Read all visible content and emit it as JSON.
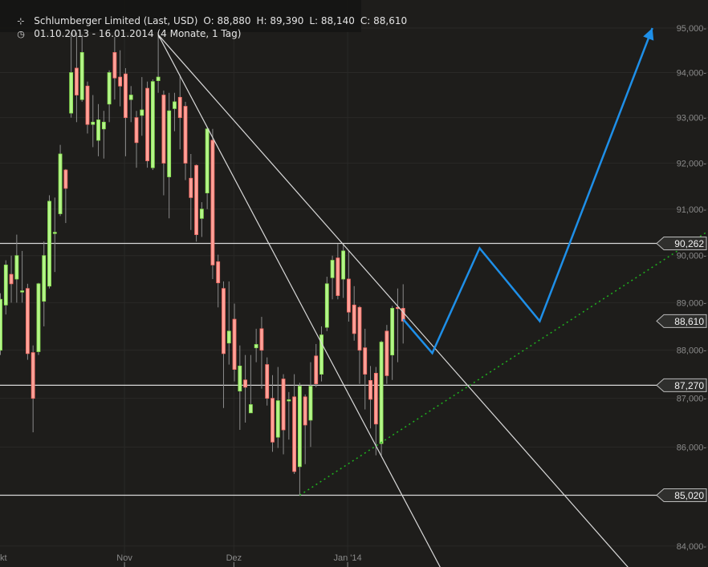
{
  "header": {
    "title": "Schlumberger Limited (Last, USD)",
    "open": "O: 88,880",
    "high": "H: 89,390",
    "low": "L: 88,140",
    "close": "C: 88,610",
    "range": "01.10.2013 - 16.01.2014 (4 Monate, 1 Tag)",
    "title_icon": "chart-bars-icon",
    "range_icon": "clock-icon"
  },
  "chart_data": {
    "type": "candlestick",
    "title": "Schlumberger Limited (Last, USD)",
    "y_scale": "log",
    "ylim": [
      84,
      95
    ],
    "y_ticks": [
      {
        "v": 95,
        "label": "95,000-"
      },
      {
        "v": 94,
        "label": "94,000-"
      },
      {
        "v": 93,
        "label": "93,000-"
      },
      {
        "v": 92,
        "label": "92,000-"
      },
      {
        "v": 91,
        "label": "91,000-"
      },
      {
        "v": 90,
        "label": "90,000-"
      },
      {
        "v": 89,
        "label": "89,000-"
      },
      {
        "v": 88,
        "label": "88,000-"
      },
      {
        "v": 87,
        "label": "87,000-"
      },
      {
        "v": 86,
        "label": "86,000-"
      },
      {
        "v": 84,
        "label": "84,000-"
      }
    ],
    "x_ticks": [
      {
        "index": -0.5,
        "label": "kt"
      },
      {
        "index": 22.8,
        "label": "Nov"
      },
      {
        "index": 42.9,
        "label": "Dez"
      },
      {
        "index": 63.8,
        "label": "Jan '14"
      }
    ],
    "colors": {
      "up_fill": "#b4f58a",
      "up_stroke": "#86e04c",
      "down_fill": "#ffa299",
      "down_stroke": "#f46a62",
      "wick": "#8a8a8a",
      "projection": "#1e8fe8",
      "support": "#1fb51f",
      "line": "#d8d8d8"
    },
    "candles": [
      [
        88.0,
        89.2,
        87.9,
        89.07
      ],
      [
        88.95,
        89.9,
        88.75,
        89.8
      ],
      [
        89.6,
        90.0,
        89.0,
        89.4
      ],
      [
        89.5,
        90.45,
        89.0,
        90.0
      ],
      [
        89.25,
        90.1,
        89.0,
        89.25
      ],
      [
        89.3,
        89.4,
        87.8,
        87.93
      ],
      [
        87.95,
        88.1,
        86.3,
        87.0
      ],
      [
        87.97,
        89.42,
        87.9,
        89.4
      ],
      [
        89.03,
        90.3,
        88.5,
        90.0
      ],
      [
        89.35,
        91.3,
        89.3,
        91.17
      ],
      [
        90.5,
        91.25,
        89.65,
        90.5
      ],
      [
        90.9,
        92.4,
        90.85,
        92.2
      ],
      [
        91.85,
        91.87,
        90.7,
        91.45
      ],
      [
        93.1,
        94.9,
        93.0,
        94.0
      ],
      [
        94.1,
        94.9,
        92.9,
        93.5
      ],
      [
        93.4,
        94.85,
        93.35,
        94.45
      ],
      [
        93.7,
        93.8,
        92.65,
        92.85
      ],
      [
        92.85,
        93.5,
        92.35,
        92.9
      ],
      [
        92.5,
        93.3,
        92.15,
        92.95
      ],
      [
        92.75,
        93.15,
        92.1,
        92.9
      ],
      [
        93.3,
        94.05,
        92.9,
        94.0
      ],
      [
        94.45,
        94.8,
        93.4,
        93.88
      ],
      [
        93.9,
        94.5,
        93.25,
        93.7
      ],
      [
        93.97,
        94.1,
        92.15,
        93.0
      ],
      [
        93.4,
        93.7,
        92.9,
        93.5
      ],
      [
        93.0,
        93.15,
        91.9,
        92.45
      ],
      [
        93.05,
        93.9,
        92.6,
        93.17
      ],
      [
        93.65,
        93.8,
        91.9,
        92.05
      ],
      [
        91.9,
        93.85,
        91.85,
        93.8
      ],
      [
        93.82,
        94.85,
        93.55,
        93.9
      ],
      [
        93.5,
        93.6,
        91.3,
        92.0
      ],
      [
        91.7,
        93.55,
        90.8,
        93.15
      ],
      [
        93.2,
        93.55,
        92.7,
        93.35
      ],
      [
        93.45,
        93.95,
        92.3,
        93.0
      ],
      [
        93.25,
        93.35,
        91.63,
        92.0
      ],
      [
        91.67,
        92.2,
        90.55,
        91.25
      ],
      [
        91.95,
        91.97,
        90.3,
        90.45
      ],
      [
        90.8,
        91.15,
        90.4,
        91.0
      ],
      [
        91.35,
        92.8,
        91.0,
        92.75
      ],
      [
        92.5,
        92.75,
        89.5,
        89.8
      ],
      [
        89.87,
        90.02,
        88.9,
        89.42
      ],
      [
        89.3,
        89.45,
        86.8,
        87.93
      ],
      [
        88.15,
        89.45,
        87.7,
        88.4
      ],
      [
        88.65,
        88.98,
        87.35,
        87.6
      ],
      [
        87.15,
        88.1,
        86.35,
        87.67
      ],
      [
        87.38,
        87.9,
        86.5,
        87.23
      ],
      [
        86.7,
        87.9,
        86.7,
        86.87
      ],
      [
        88.05,
        88.45,
        87.75,
        88.12
      ],
      [
        88.45,
        88.7,
        87.2,
        88.0
      ],
      [
        87.7,
        87.85,
        86.85,
        87.0
      ],
      [
        87.0,
        87.48,
        85.9,
        86.1
      ],
      [
        86.2,
        87.65,
        85.98,
        86.95
      ],
      [
        87.4,
        87.5,
        85.85,
        86.35
      ],
      [
        86.97,
        87.13,
        86.15,
        86.97
      ],
      [
        87.03,
        87.5,
        85.45,
        85.5
      ],
      [
        85.6,
        87.32,
        85.02,
        87.25
      ],
      [
        87.03,
        87.08,
        85.65,
        86.45
      ],
      [
        86.55,
        87.75,
        86.0,
        87.25
      ],
      [
        87.88,
        88.13,
        87.23,
        87.3
      ],
      [
        87.5,
        88.5,
        87.35,
        88.32
      ],
      [
        88.48,
        89.55,
        88.4,
        89.4
      ],
      [
        89.53,
        90.0,
        89.07,
        89.9
      ],
      [
        89.95,
        90.25,
        89.07,
        89.15
      ],
      [
        89.5,
        90.25,
        89.1,
        90.1
      ],
      [
        89.5,
        90.1,
        88.6,
        88.8
      ],
      [
        88.95,
        89.35,
        88.2,
        88.35
      ],
      [
        88.9,
        88.93,
        87.3,
        88.0
      ],
      [
        88.05,
        88.45,
        86.77,
        87.5
      ],
      [
        87.37,
        87.67,
        86.38,
        86.98
      ],
      [
        87.52,
        87.65,
        85.83,
        86.47
      ],
      [
        86.07,
        88.2,
        85.83,
        88.17
      ],
      [
        88.4,
        88.53,
        87.3,
        87.47
      ],
      [
        87.9,
        88.93,
        87.38,
        88.88
      ],
      [
        88.9,
        89.3,
        87.75,
        88.88
      ],
      [
        88.88,
        89.39,
        88.14,
        88.61
      ]
    ],
    "horizontal_levels": [
      {
        "v": 90.262,
        "label": "90,262"
      },
      {
        "v": 87.27,
        "label": "87,270"
      },
      {
        "v": 85.02,
        "label": "85,020"
      }
    ],
    "last_price": {
      "v": 88.61,
      "label": "88,610"
    },
    "trendlines": [
      {
        "from": [
          29.0,
          94.85
        ],
        "to": [
          80.8,
          83.58
        ]
      },
      {
        "from": [
          29.0,
          94.85
        ],
        "to": [
          115.3,
          83.58
        ]
      }
    ],
    "support_line": {
      "from": [
        55.0,
        85.02
      ],
      "to": [
        130.1,
        90.53
      ]
    },
    "projection": [
      [
        74.0,
        88.65
      ],
      [
        79.35,
        87.94
      ],
      [
        88.05,
        90.16
      ],
      [
        99.1,
        88.61
      ],
      [
        119.8,
        95.0
      ]
    ]
  }
}
